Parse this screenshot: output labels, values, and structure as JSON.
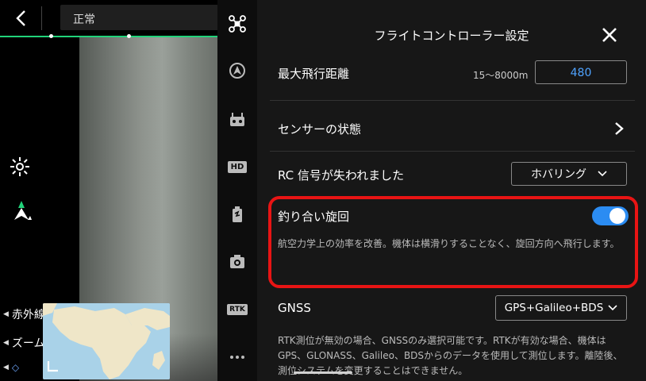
{
  "top": {
    "status": "正常"
  },
  "left_panel": {
    "ir_label": "赤外線",
    "zoom_label": "ズーム"
  },
  "settings": {
    "title": "フライトコントローラー設定",
    "max_distance": {
      "label": "最大飛行距離",
      "range": "15〜8000m",
      "value": "480"
    },
    "sensor_status": {
      "label": "センサーの状態"
    },
    "rc_lost": {
      "label": "RC 信号が失われました",
      "value": "ホバリング"
    },
    "coordinated_turn": {
      "label": "釣り合い旋回",
      "enabled": true,
      "description": "航空力学上の効率を改善。機体は横滑りすることなく、旋回方向へ飛行します。"
    },
    "gnss": {
      "label": "GNSS",
      "value": "GPS+Galileo+BDS",
      "description": "RTK測位が無効の場合、GNSSのみ選択可能です。RTKが有効な場合、機体はGPS、GLONASS、Galileo、BDSからのデータを使用して測位します。離陸後、測位システムを変更することはできません。"
    }
  },
  "toolbar": {
    "hd_label": "HD",
    "rtk_label": "RTK"
  },
  "colors": {
    "accent_green": "#21d37a",
    "toggle_blue": "#2b8cf2",
    "value_blue": "#4fa3ff",
    "highlight_red": "#e81414"
  }
}
